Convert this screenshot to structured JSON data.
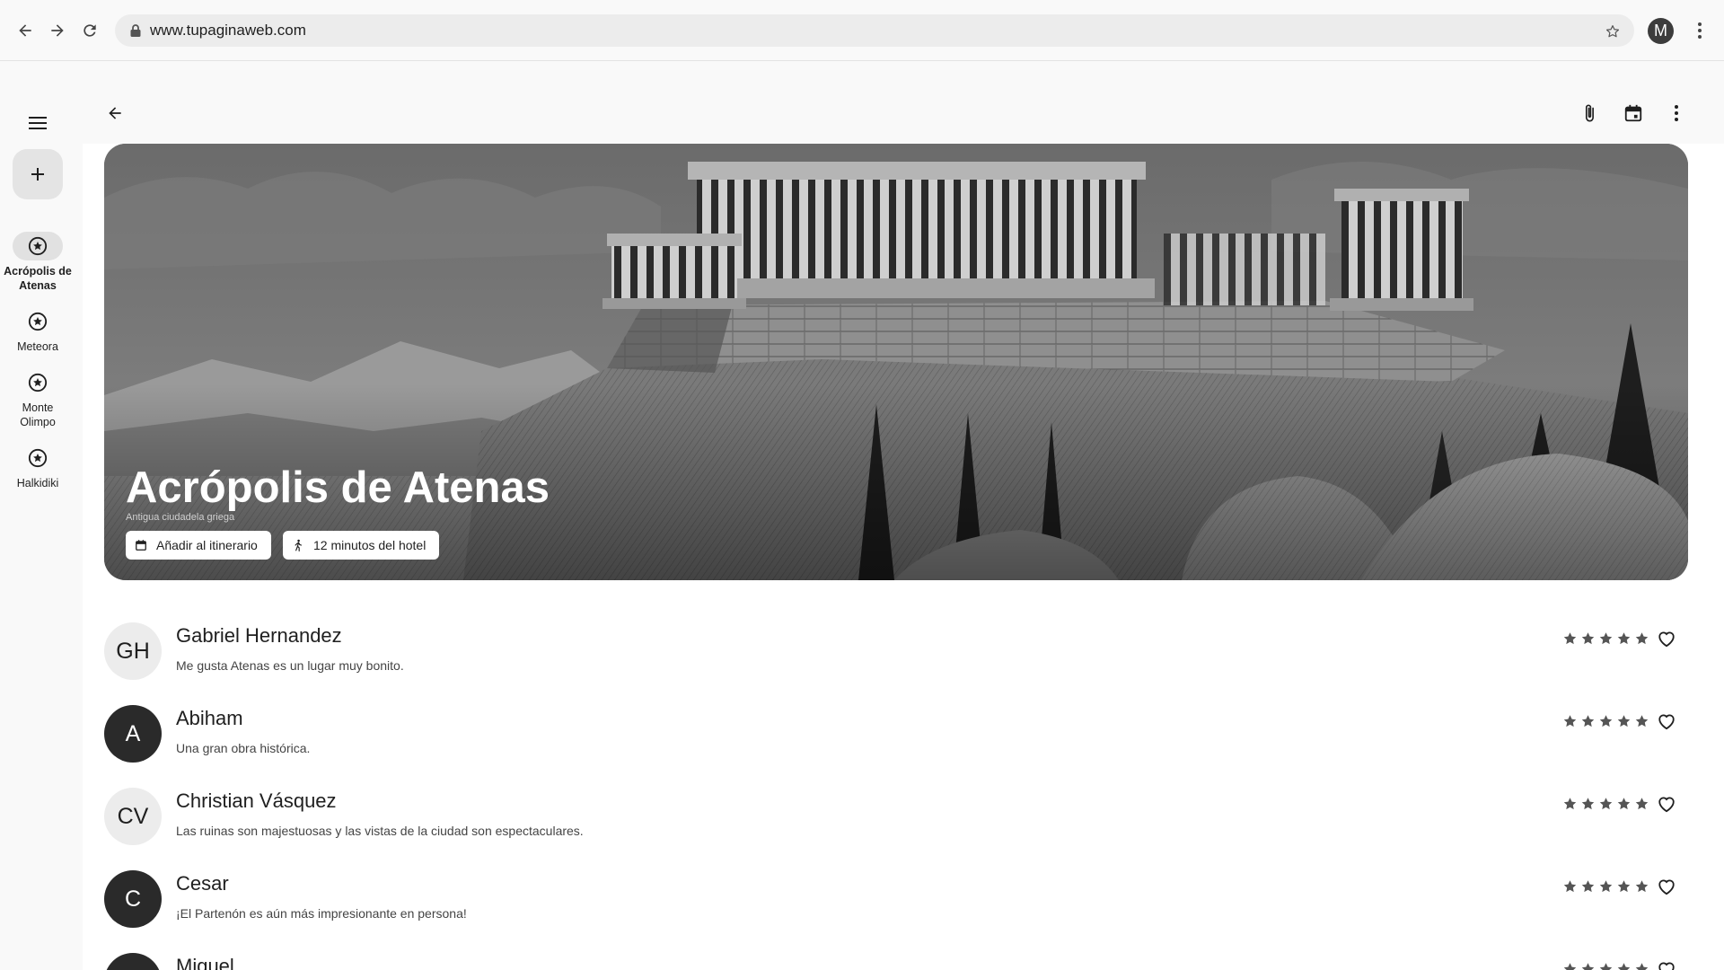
{
  "browser": {
    "url": "www.tupaginaweb.com",
    "profile_initial": "M"
  },
  "rail": {
    "items": [
      {
        "label": "Acrópolis de Atenas",
        "active": true
      },
      {
        "label": "Meteora",
        "active": false
      },
      {
        "label": "Monte Olimpo",
        "active": false
      },
      {
        "label": "Halkidiki",
        "active": false
      }
    ]
  },
  "hero": {
    "title": "Acrópolis de Atenas",
    "subtitle": "Antigua ciudadela griega",
    "chips": [
      {
        "label": "Añadir al itinerario",
        "icon": "calendar-icon"
      },
      {
        "label": "12 minutos del hotel",
        "icon": "walking-icon"
      }
    ]
  },
  "reviews": [
    {
      "initials": "GH",
      "name": "Gabriel Hernandez",
      "text": "Me gusta Atenas es un lugar muy bonito.",
      "rating": 5,
      "avatar_style": "light"
    },
    {
      "initials": "A",
      "name": "Abiham",
      "text": "Una gran obra histórica.",
      "rating": 5,
      "avatar_style": "dark"
    },
    {
      "initials": "CV",
      "name": "Christian Vásquez",
      "text": "Las ruinas son majestuosas y las vistas de la ciudad son espectaculares.",
      "rating": 5,
      "avatar_style": "light"
    },
    {
      "initials": "C",
      "name": "Cesar",
      "text": "¡El Partenón es aún más impresionante en persona!",
      "rating": 5,
      "avatar_style": "dark"
    },
    {
      "initials": "",
      "name": "Miguel",
      "text": "",
      "rating": 5,
      "avatar_style": "dark"
    }
  ],
  "icons": {
    "toolbar": [
      "attachment-icon",
      "calendar-icon",
      "more-vert-icon"
    ]
  },
  "colors": {
    "background": "#f9f9f9",
    "surface": "#ffffff",
    "chip": "#ffffff",
    "dark_avatar": "#2a2a2a",
    "light_avatar": "#ececec"
  }
}
